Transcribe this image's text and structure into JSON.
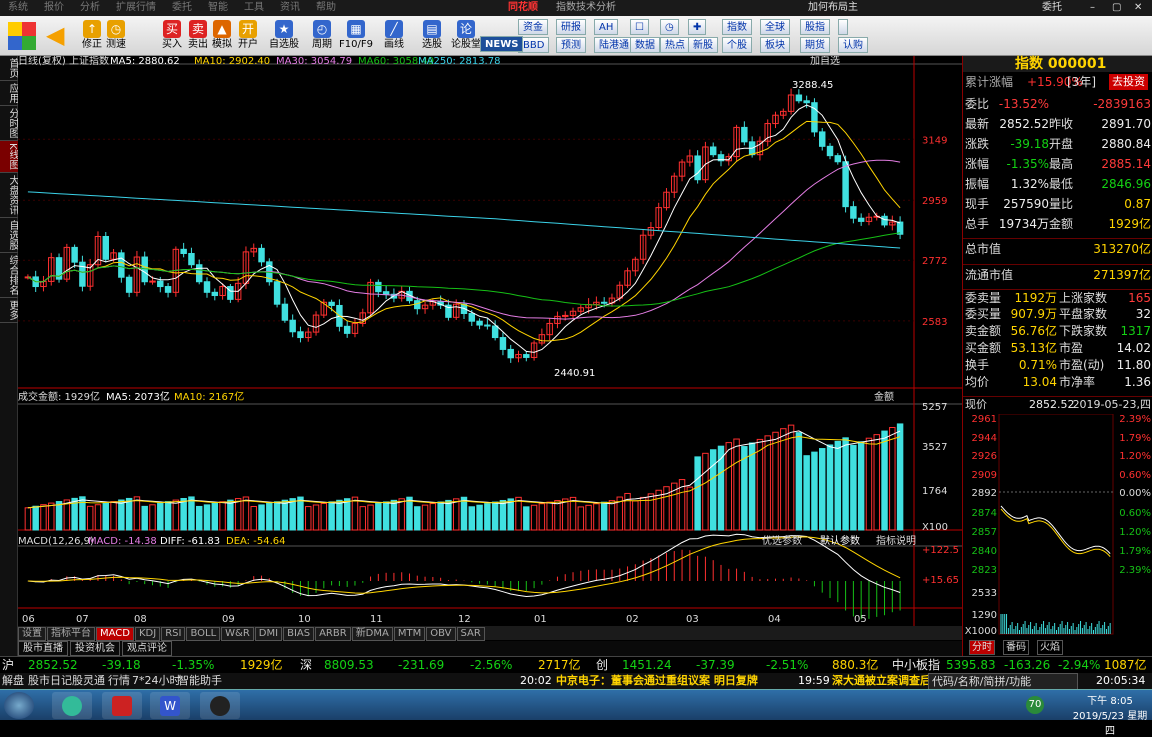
{
  "menubar": {
    "items": [
      "系统",
      "报价",
      "分析",
      "扩展行情",
      "委托",
      "智能",
      "工具",
      "资讯",
      "帮助"
    ],
    "trade_btn": "委托",
    "right_menu": "加何布局主"
  },
  "app": {
    "logo": "同花顺",
    "title": "指数技术分析"
  },
  "toolbar": {
    "buttons": [
      {
        "label": "修正",
        "icon": "↑"
      },
      {
        "label": "测速",
        "icon": "◷"
      },
      {
        "label": "买入",
        "icon": "买"
      },
      {
        "label": "卖出",
        "icon": "卖"
      },
      {
        "label": "模拟",
        "icon": "▲"
      },
      {
        "label": "开户",
        "icon": "开"
      },
      {
        "label": "自选股",
        "icon": "★"
      },
      {
        "label": "周期",
        "icon": "◴"
      },
      {
        "label": "F10/F9",
        "icon": "▦"
      },
      {
        "label": "画线",
        "icon": "╱"
      },
      {
        "label": "选股",
        "icon": "▤"
      },
      {
        "label": "论股堂",
        "icon": "论"
      },
      {
        "label": "资讯",
        "icon": "N"
      }
    ],
    "btn_small": [
      {
        "top": "资金",
        "bottom": "BBD"
      },
      {
        "top": "研报",
        "bottom": "预测"
      },
      {
        "top": "AH",
        "bottom": "陆港通"
      },
      {
        "top": "☐",
        "bottom": "数据"
      },
      {
        "top": "◷",
        "bottom": "热点"
      },
      {
        "top": "✚",
        "bottom": "新股"
      },
      {
        "top": "指数",
        "bottom": "个股"
      },
      {
        "top": "全球",
        "bottom": "板块"
      },
      {
        "top": "股指",
        "bottom": "期货"
      },
      {
        "top": "",
        "bottom": "认购"
      }
    ],
    "news_label": "NEWS"
  },
  "leftbar": {
    "items": [
      "首页",
      "应用",
      "分时图",
      "K线图",
      "大盘资讯",
      "自选股",
      "综合排名",
      "更多"
    ],
    "active": 3
  },
  "chart": {
    "labels": {
      "kline": "日线(复权) 上证指数",
      "ma5": "MA5: 2880.62",
      "ma10": "MA10: 2902.40",
      "ma30": "MA30: 3054.79",
      "ma60": "MA60: 3058.49",
      "ma250": "MA250: 2813.78",
      "vol": "成交金额: 1929亿",
      "vol_ma5": "MA5: 2073亿",
      "vol_ma10": "MA10: 2167亿",
      "macd": "MACD(12,26,9)",
      "macd_v": "MACD: -14.38",
      "diff": "DIFF: -61.83",
      "dea": "DEA: -54.64",
      "add": "加自选",
      "vol_sel": "金额",
      "opt1": "优选参数",
      "opt2": "默认参数",
      "opt3": "指标说明"
    },
    "price_ticks": [
      "3149",
      "2959",
      "2772",
      "2583"
    ],
    "vol_ticks": [
      "5257",
      "3527",
      "1764",
      "X100"
    ],
    "macd_ticks": [
      "+122.5",
      "+15.65"
    ],
    "high_label": "3288.45",
    "low_label": "2440.91",
    "months": [
      "06",
      "07",
      "08",
      "09",
      "10",
      "11",
      "12",
      "01",
      "02",
      "03",
      "04",
      "05"
    ]
  },
  "chart_data": {
    "type": "candlestick",
    "series": [
      {
        "name": "日线(复权) 上证指数",
        "values": [
          2720,
          2690,
          2706,
          2780,
          2713,
          2812,
          2766,
          2691,
          2758,
          2846,
          2775,
          2795,
          2719,
          2672,
          2782,
          2705,
          2707,
          2690,
          2672,
          2806,
          2793,
          2758,
          2705,
          2672,
          2662,
          2690,
          2650,
          2700,
          2798,
          2809,
          2767,
          2705,
          2635,
          2585,
          2549,
          2531,
          2548,
          2601,
          2641,
          2631,
          2566,
          2544,
          2575,
          2608,
          2703,
          2674,
          2666,
          2654,
          2675,
          2646,
          2621,
          2632,
          2643,
          2632,
          2594,
          2635,
          2606,
          2582,
          2570,
          2567,
          2531,
          2494,
          2468,
          2478,
          2469,
          2514,
          2540,
          2575,
          2597,
          2600,
          2613,
          2624,
          2634,
          2641,
          2639,
          2654,
          2694,
          2739,
          2775,
          2850,
          2874,
          2936,
          2984,
          3034,
          3078,
          3097,
          3023,
          3125,
          3101,
          3082,
          3095,
          3186,
          3141,
          3101,
          3143,
          3198,
          3224,
          3236,
          3287,
          3269,
          3263,
          3172,
          3127,
          3098,
          3079,
          2939,
          2903,
          2893,
          2906,
          2909,
          2882,
          2891,
          2853
        ]
      }
    ]
  },
  "rightpanel": {
    "title": "指数 000001",
    "rate_lbl": "累计涨幅",
    "rate": "+15.90%",
    "rate_range": "[3年]",
    "invest_btn": "去投资",
    "rows": [
      {
        "l": "委比",
        "v": "-13.52%",
        "l2": "",
        "v2": "-2839163"
      },
      {
        "l": "最新",
        "v": "2852.52",
        "l2": "昨收",
        "v2": "2891.70"
      },
      {
        "l": "涨跌",
        "v": "-39.18",
        "l2": "开盘",
        "v2": "2880.84"
      },
      {
        "l": "涨幅",
        "v": "-1.35%",
        "l2": "最高",
        "v2": "2885.14"
      },
      {
        "l": "振幅",
        "v": "1.32%",
        "l2": "最低",
        "v2": "2846.96"
      },
      {
        "l": "现手",
        "v": "257590",
        "l2": "量比",
        "v2": "0.87"
      },
      {
        "l": "总手",
        "v": "19734万",
        "l2": "金额",
        "v2": "1929亿"
      }
    ],
    "market": [
      {
        "l": "总市值",
        "v": "313270亿"
      },
      {
        "l": "流通市值",
        "v": "271397亿"
      }
    ],
    "stats": [
      {
        "l": "委卖量",
        "v": "1192万",
        "l2": "上涨家数",
        "v2": "165"
      },
      {
        "l": "委买量",
        "v": "907.9万",
        "l2": "平盘家数",
        "v2": "32"
      },
      {
        "l": "卖金额",
        "v": "56.76亿",
        "l2": "下跌家数",
        "v2": "1317"
      },
      {
        "l": "买金额",
        "v": "53.13亿",
        "l2": "市盈",
        "v2": "14.02"
      },
      {
        "l": "换手",
        "v": "0.71%",
        "l2": "市盈(动)",
        "v2": "11.80"
      },
      {
        "l": "均价",
        "v": "13.04",
        "l2": "市净率",
        "v2": "1.36"
      }
    ],
    "mini": {
      "title": "现价",
      "price": "2852.52",
      "date": "2019-05-23,四",
      "left_ticks": [
        "2961",
        "2944",
        "2926",
        "2909",
        "2892",
        "2874",
        "2857",
        "2840",
        "2823",
        "2533",
        "1290",
        "X1000"
      ],
      "right_ticks": [
        "2.39%",
        "1.79%",
        "1.20%",
        "0.60%",
        "0.00%",
        "0.60%",
        "1.20%",
        "1.79%",
        "2.39%"
      ],
      "tabs": [
        "分时",
        "番码",
        "火焰"
      ]
    }
  },
  "bottomtabs": [
    "设置",
    "指标平台",
    "MACD",
    "KDJ",
    "RSI",
    "BOLL",
    "W&R",
    "DMI",
    "BIAS",
    "ARBR",
    "新DMA",
    "MTM",
    "OBV",
    "SAR"
  ],
  "bottomtabs_sel": 2,
  "tabs2": [
    "股市直播",
    "投资机会",
    "观点评论"
  ],
  "ticker": [
    {
      "n": "沪",
      "p": "2852.52",
      "c": "-39.18",
      "pc": "-1.35%",
      "a": "1929亿"
    },
    {
      "n": "深",
      "p": "8809.53",
      "c": "-231.69",
      "pc": "-2.56%",
      "a": "2717亿"
    },
    {
      "n": "创",
      "p": "1451.24",
      "c": "-37.39",
      "pc": "-2.51%",
      "a": "880.3亿"
    },
    {
      "n": "中小板指",
      "p": "5395.83",
      "c": "-163.26",
      "pc": "-2.94%",
      "a": "1087亿"
    }
  ],
  "status": {
    "items": [
      "解盘",
      "股市日记",
      "股灵通",
      "行情",
      "7*24小时",
      "智能助手"
    ],
    "news1_time": "20:02",
    "news1": "中京电子：董事会通过重组议案 明日复牌",
    "news2_time": "19:59",
    "news2": "深大通被立案调查后",
    "code_hint": "代码/名称/简拼/功能",
    "clock": "20:05:34"
  },
  "taskbar": {
    "time": "下午 8:05",
    "date": "2019/5/23 星期四",
    "badge": "70"
  }
}
